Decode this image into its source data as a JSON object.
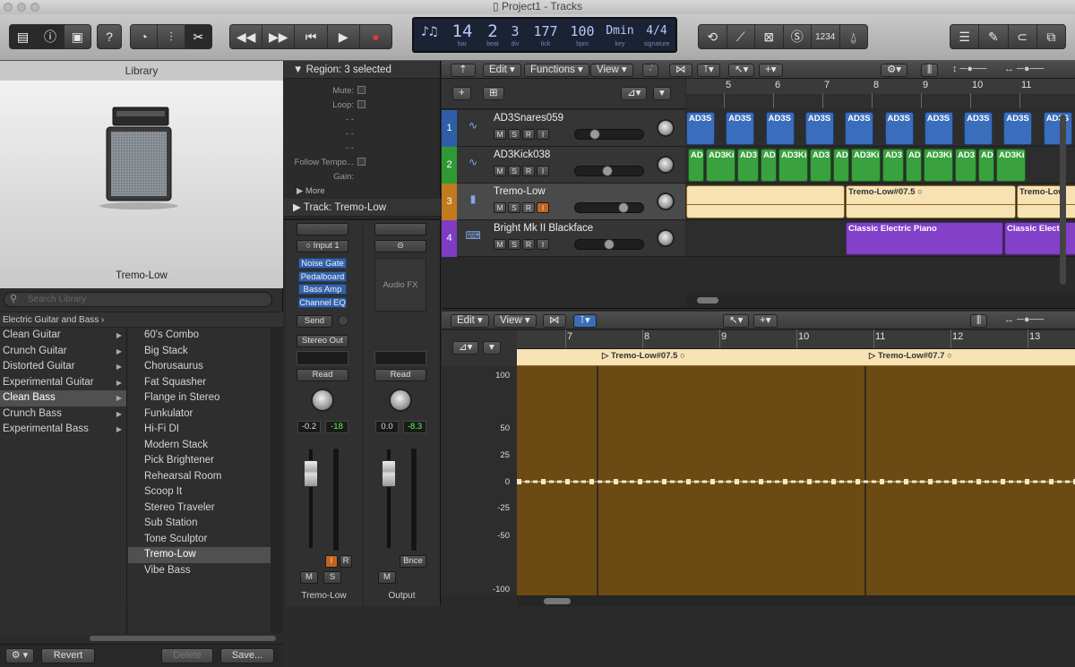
{
  "window": {
    "title": "Project1 - Tracks"
  },
  "toolbar": {
    "view_buttons": [
      "library-icon",
      "info-icon",
      "editor-icon"
    ],
    "lcd": {
      "bar": {
        "value": "14",
        "label": "bar"
      },
      "beat": {
        "value": "2",
        "label": "beat"
      },
      "div": {
        "value": "3",
        "label": "div"
      },
      "tick": {
        "value": "177",
        "label": "tick"
      },
      "bpm": {
        "value": "100",
        "label": "bpm"
      },
      "key": {
        "value": "Dmin",
        "label": "key"
      },
      "signature": {
        "value": "4/4",
        "label": "signature"
      }
    },
    "count_in": "1234"
  },
  "library": {
    "header": "Library",
    "patch_name": "Tremo-Low",
    "search_placeholder": "Search Library",
    "path": "Electric Guitar and Bass",
    "categories": [
      {
        "label": "Clean Guitar",
        "selected": false
      },
      {
        "label": "Crunch Guitar",
        "selected": false
      },
      {
        "label": "Distorted Guitar",
        "selected": false
      },
      {
        "label": "Experimental Guitar",
        "selected": false
      },
      {
        "label": "Clean Bass",
        "selected": true
      },
      {
        "label": "Crunch Bass",
        "selected": false
      },
      {
        "label": "Experimental Bass",
        "selected": false
      }
    ],
    "patches": [
      {
        "label": "60's Combo",
        "selected": false
      },
      {
        "label": "Big Stack",
        "selected": false
      },
      {
        "label": "Chorusaurus",
        "selected": false
      },
      {
        "label": "Fat Squasher",
        "selected": false
      },
      {
        "label": "Flange in Stereo",
        "selected": false
      },
      {
        "label": "Funkulator",
        "selected": false
      },
      {
        "label": "Hi-Fi DI",
        "selected": false
      },
      {
        "label": "Modern Stack",
        "selected": false
      },
      {
        "label": "Pick Brightener",
        "selected": false
      },
      {
        "label": "Rehearsal Room",
        "selected": false
      },
      {
        "label": "Scoop It",
        "selected": false
      },
      {
        "label": "Stereo Traveler",
        "selected": false
      },
      {
        "label": "Sub Station",
        "selected": false
      },
      {
        "label": "Tone Sculptor",
        "selected": false
      },
      {
        "label": "Tremo-Low",
        "selected": true
      },
      {
        "label": "Vibe Bass",
        "selected": false
      }
    ],
    "footer": {
      "revert": "Revert",
      "delete": "Delete",
      "save": "Save..."
    }
  },
  "inspector": {
    "region_header": "Region: 3 selected",
    "params": [
      {
        "label": "Mute:",
        "type": "check"
      },
      {
        "label": "Loop:",
        "type": "check"
      },
      {
        "label": "",
        "value": "- -"
      },
      {
        "label": "",
        "value": "- -"
      },
      {
        "label": "",
        "value": "- -"
      },
      {
        "label": "Follow Tempo...",
        "type": "check"
      },
      {
        "label": "Gain:",
        "value": ""
      }
    ],
    "more": "More",
    "track_header": "Track:  Tremo-Low",
    "strip1": {
      "input": "Input 1",
      "plugins": [
        "Noise Gate",
        "Pedalboard",
        "Bass Amp",
        "Channel EQ"
      ],
      "send": "Send",
      "output": "Stereo Out",
      "automation": "Read",
      "pan_value": "-0.2",
      "peak_value": "-18",
      "mute": "M",
      "solo": "S",
      "input_monitor": "I",
      "record": "R",
      "name": "Tremo-Low"
    },
    "strip2": {
      "audio_fx": "Audio FX",
      "automation": "Read",
      "pan_value": "0.0",
      "peak_value": "-8.3",
      "mute": "M",
      "bounce": "Bnce",
      "name": "Output"
    }
  },
  "tracks_area": {
    "menus": {
      "edit": "Edit",
      "functions": "Functions",
      "view": "View"
    },
    "ruler": [
      "5",
      "6",
      "7",
      "8",
      "9",
      "10",
      "11"
    ],
    "tracks": [
      {
        "num": "1",
        "name": "AD3Snares059",
        "color": "#2f5ea8"
      },
      {
        "num": "2",
        "name": "AD3Kick038",
        "color": "#2f9a34"
      },
      {
        "num": "3",
        "name": "Tremo-Low",
        "color": "#c37a1f"
      },
      {
        "num": "4",
        "name": "Bright Mk II Blackface",
        "color": "#7d3cc2"
      }
    ],
    "buttons": {
      "mute": "M",
      "solo": "S",
      "record": "R",
      "input": "I"
    },
    "snare_region_label": "AD3S",
    "kick_labels": [
      "AD",
      "AD3Ki",
      "AD3",
      "AD",
      "AD3Ki",
      "AD3",
      "AD",
      "AD3Ki",
      "AD3",
      "AD",
      "AD3Ki",
      "AD3",
      "AD",
      "AD3Ki"
    ],
    "tremo_regions": [
      "Tremo-Low#07.5",
      "Tremo-Low"
    ],
    "piano_regions": [
      "Classic Electric Piano",
      "Classic Elect"
    ]
  },
  "editor": {
    "menus": {
      "edit": "Edit",
      "view": "View"
    },
    "ruler": [
      "7",
      "8",
      "9",
      "10",
      "11",
      "12",
      "13"
    ],
    "regions": [
      "Tremo-Low#07.5",
      "Tremo-Low#07.7"
    ],
    "y_labels": [
      "100",
      "50",
      "25",
      "0",
      "-25",
      "-50",
      "-100"
    ]
  }
}
